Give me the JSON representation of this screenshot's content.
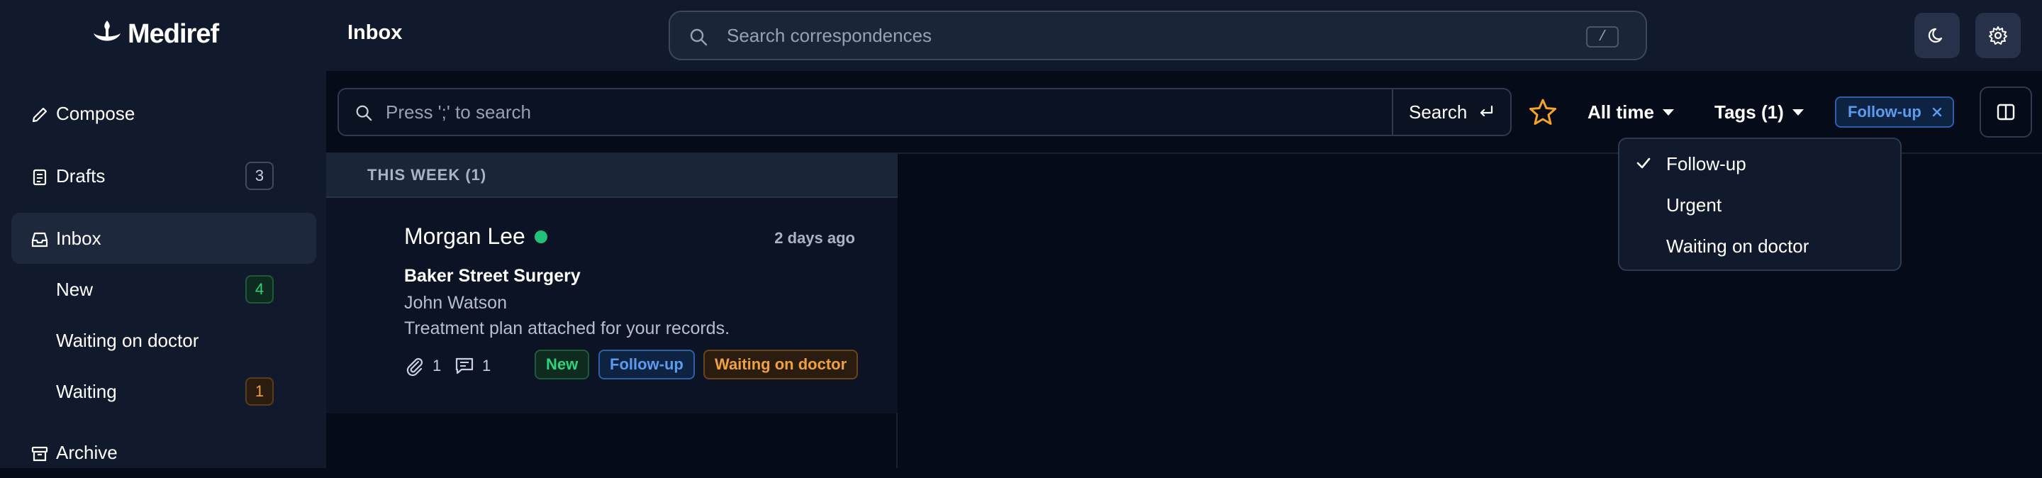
{
  "app": {
    "logo_text": "Mediref",
    "page_title": "Inbox"
  },
  "global_search": {
    "placeholder": "Search correspondences",
    "shortcut": "/"
  },
  "header_icons": [
    "moon-icon",
    "gear-icon"
  ],
  "sidebar": {
    "items": [
      {
        "label": "Compose",
        "icon": "pencil-icon"
      },
      {
        "label": "Drafts",
        "icon": "drafts-icon",
        "count": "3"
      },
      {
        "label": "Inbox",
        "icon": "inbox-icon",
        "active": true
      },
      {
        "label": "New",
        "count": "4"
      },
      {
        "label": "Waiting on doctor"
      },
      {
        "label": "Waiting",
        "count": "1"
      },
      {
        "label": "Archive",
        "icon": "archive-icon"
      }
    ]
  },
  "list_search": {
    "placeholder": "Press ';' to search",
    "button_label": "Search"
  },
  "filters": {
    "time_label": "All time",
    "tags_label": "Tags (1)",
    "active_chip": "Follow-up"
  },
  "tags_dropdown": {
    "options": [
      {
        "label": "Follow-up",
        "checked": true
      },
      {
        "label": "Urgent",
        "checked": false
      },
      {
        "label": "Waiting on doctor",
        "checked": false
      }
    ]
  },
  "list": {
    "group_label": "THIS WEEK (1)",
    "messages": [
      {
        "sender": "Morgan Lee",
        "time": "2 days ago",
        "subject": "Baker Street Surgery",
        "person": "John Watson",
        "preview": "Treatment plan attached for your records.",
        "attachments": "1",
        "comments": "1",
        "tags": [
          "New",
          "Follow-up",
          "Waiting on doctor"
        ]
      }
    ]
  },
  "colors": {
    "background": "#060b1a",
    "panel": "#111a2c",
    "accent_blue": "#5b9bf0",
    "green": "#2ed47a",
    "orange": "#f0a040",
    "star": "#f5a524"
  }
}
